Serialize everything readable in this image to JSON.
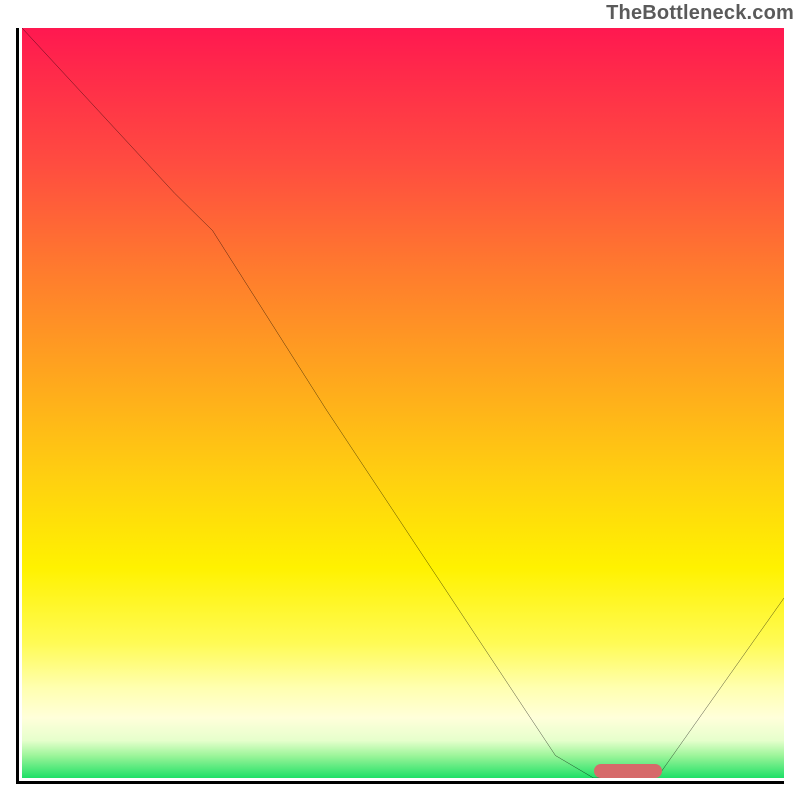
{
  "watermark": "TheBottleneck.com",
  "colors": {
    "axis": "#000000",
    "curve": "#000000",
    "marker": "#d66a6a",
    "gradient_top": "#ff1850",
    "gradient_bottom": "#1ee066"
  },
  "chart_data": {
    "type": "line",
    "title": "",
    "xlabel": "",
    "ylabel": "",
    "xlim": [
      0,
      100
    ],
    "ylim": [
      0,
      100
    ],
    "grid": false,
    "legend": false,
    "series": [
      {
        "name": "bottleneck-curve",
        "x": [
          0,
          10,
          20,
          25,
          40,
          55,
          70,
          75,
          80,
          84,
          100
        ],
        "y": [
          100,
          89,
          78,
          73,
          49,
          26,
          3,
          0,
          0,
          1,
          24
        ]
      }
    ],
    "marker": {
      "name": "optimal-range",
      "x_start": 75,
      "x_end": 84,
      "y": 0.6
    },
    "background_gradient": {
      "direction": "vertical",
      "stops": [
        {
          "pos": 0.0,
          "color": "#ff1850"
        },
        {
          "pos": 0.18,
          "color": "#ff4c40"
        },
        {
          "pos": 0.46,
          "color": "#ffa51e"
        },
        {
          "pos": 0.72,
          "color": "#fff200"
        },
        {
          "pos": 0.92,
          "color": "#ffffda"
        },
        {
          "pos": 1.0,
          "color": "#1ee066"
        }
      ]
    }
  }
}
